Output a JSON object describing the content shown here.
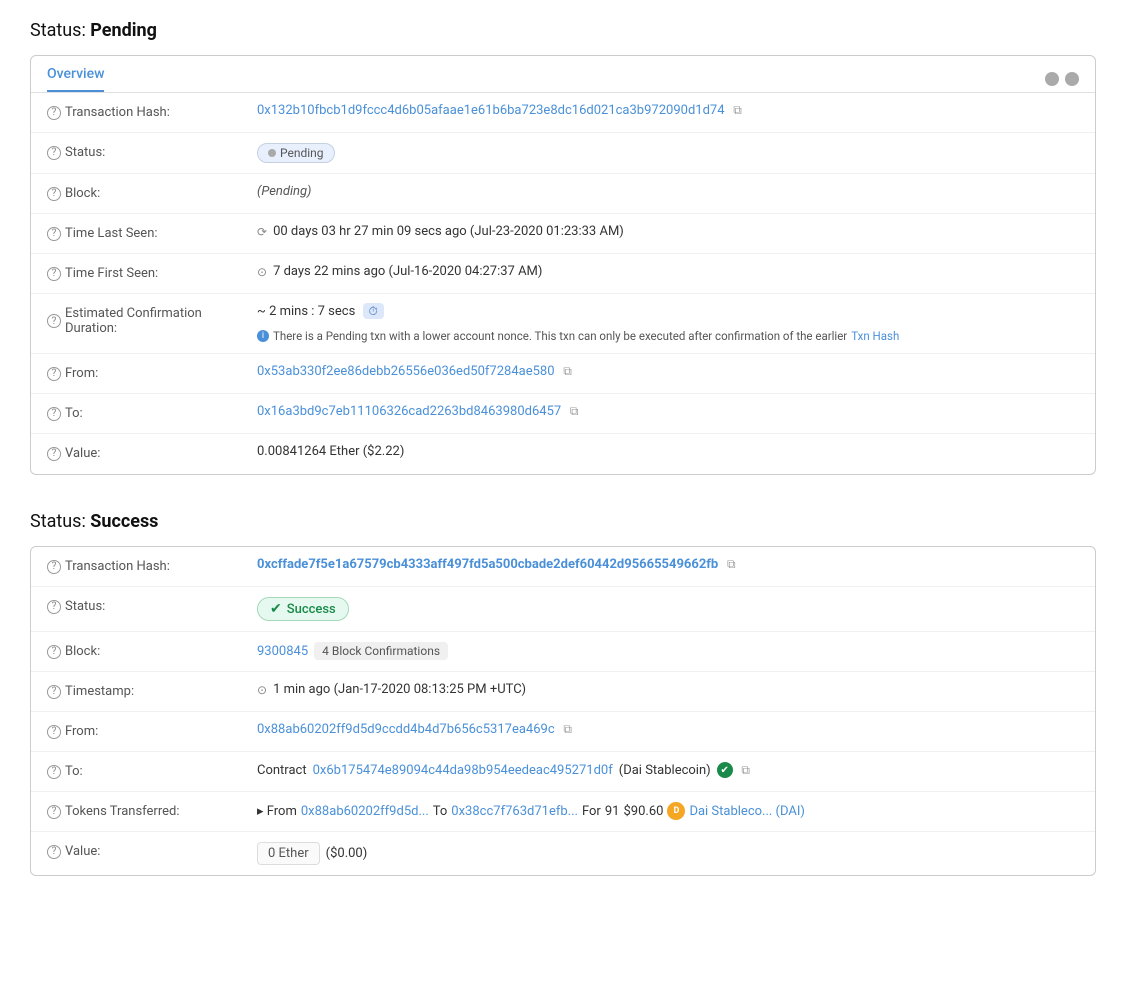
{
  "pending_section": {
    "title": "Status:",
    "title_bold": "Pending",
    "tab": {
      "label": "Overview",
      "circles": [
        "gray",
        "gray"
      ]
    },
    "rows": [
      {
        "id": "tx-hash-pending",
        "label": "Transaction Hash:",
        "value": "0x132b10fbcb1d9fccc4d6b05afaae1e61b6ba723e8dc16d021ca3b972090d1d74",
        "type": "hash-copy"
      },
      {
        "id": "status-pending",
        "label": "Status:",
        "value": "Pending",
        "type": "badge-pending"
      },
      {
        "id": "block-pending",
        "label": "Block:",
        "value": "(Pending)",
        "type": "italic"
      },
      {
        "id": "time-last-seen",
        "label": "Time Last Seen:",
        "value": "00 days 03 hr 27 min 09 secs ago (Jul-23-2020 01:23:33 AM)",
        "type": "timestamp"
      },
      {
        "id": "time-first-seen",
        "label": "Time First Seen:",
        "value": "7 days 22 mins ago (Jul-16-2020 04:27:37 AM)",
        "type": "timestamp-clock"
      },
      {
        "id": "est-confirmation",
        "label": "Estimated Confirmation Duration:",
        "value": "~ 2 mins : 7 secs",
        "badge": "⏱",
        "note": "There is a Pending txn with a lower account nonce. This txn can only be executed after confirmation of the earlier",
        "note_link": "Txn Hash",
        "type": "estimate"
      },
      {
        "id": "from-pending",
        "label": "From:",
        "value": "0x53ab330f2ee86debb26556e036ed50f7284ae580",
        "type": "address-copy"
      },
      {
        "id": "to-pending",
        "label": "To:",
        "value": "0x16a3bd9c7eb11106326cad2263bd8463980d6457",
        "type": "address-copy"
      },
      {
        "id": "value-pending",
        "label": "Value:",
        "value": "0.00841264 Ether ($2.22)",
        "type": "plain"
      }
    ]
  },
  "success_section": {
    "title": "Status:",
    "title_bold": "Success",
    "rows": [
      {
        "id": "tx-hash-success",
        "label": "Transaction Hash:",
        "value": "0xcffade7f5e1a67579cb4333aff497fd5a500cbade2def60442d95665549662fb",
        "type": "hash-copy-bold"
      },
      {
        "id": "status-success",
        "label": "Status:",
        "value": "Success",
        "type": "badge-success"
      },
      {
        "id": "block-success",
        "label": "Block:",
        "block_number": "9300845",
        "confirmations": "4 Block Confirmations",
        "type": "block-confirm"
      },
      {
        "id": "timestamp-success",
        "label": "Timestamp:",
        "value": "1 min ago (Jan-17-2020 08:13:25 PM +UTC)",
        "type": "timestamp-clock"
      },
      {
        "id": "from-success",
        "label": "From:",
        "value": "0x88ab60202ff9d5d9ccdd4b4d7b656c5317ea469c",
        "type": "address-copy"
      },
      {
        "id": "to-success",
        "label": "To:",
        "contract_prefix": "Contract",
        "contract_address": "0x6b175474e89094c44da98b954eedeac495271d0f",
        "contract_name": "(Dai Stablecoin)",
        "type": "contract"
      },
      {
        "id": "tokens-transferred",
        "label": "Tokens Transferred:",
        "from_address": "0x88ab60202ff9d5d...",
        "to_address": "0x38cc7f763d71efb...",
        "amount": "91",
        "usd": "$90.60",
        "token_name": "Dai Stableco... (DAI)",
        "type": "token-transfer"
      },
      {
        "id": "value-success",
        "label": "Value:",
        "ether": "0 Ether",
        "usd": "($0.00)",
        "type": "value-box"
      }
    ]
  },
  "labels": {
    "from_arrow": "▸ From",
    "to_label": "To",
    "for_label": "For",
    "contract_label": "Contract"
  }
}
